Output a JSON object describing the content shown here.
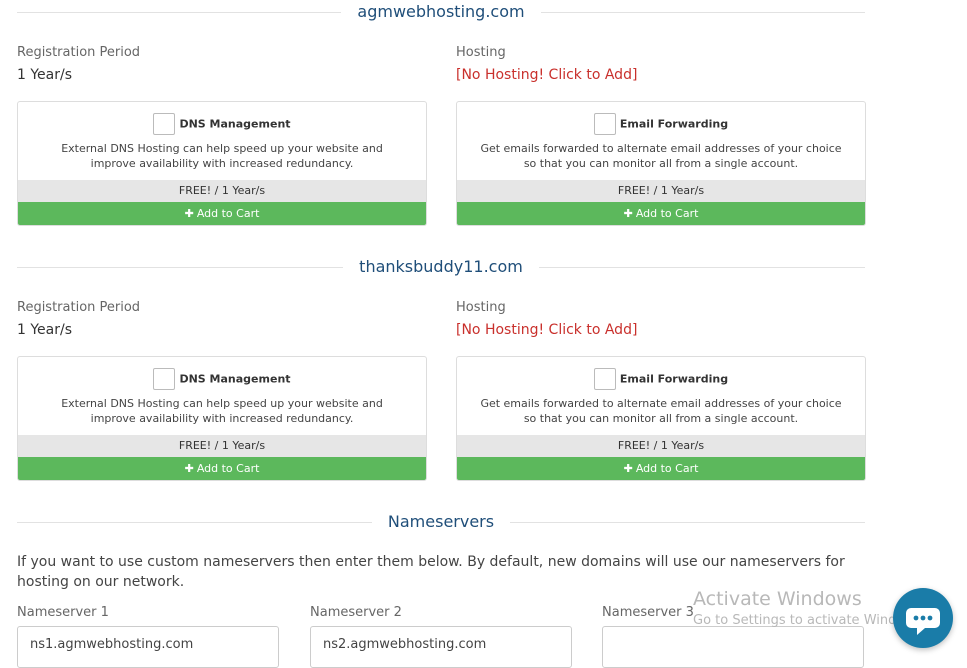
{
  "domains": [
    {
      "name": "agmwebhosting.com",
      "registration_label": "Registration Period",
      "registration_value": "1 Year/s",
      "hosting_label": "Hosting",
      "hosting_link": "[No Hosting! Click to Add]",
      "addons": [
        {
          "title": "DNS Management",
          "description": "External DNS Hosting can help speed up your website and improve availability with increased redundancy.",
          "price": "FREE! / 1 Year/s",
          "cart": "Add to Cart"
        },
        {
          "title": "Email Forwarding",
          "description": "Get emails forwarded to alternate email addresses of your choice so that you can monitor all from a single account.",
          "price": "FREE! / 1 Year/s",
          "cart": "Add to Cart"
        }
      ]
    },
    {
      "name": "thanksbuddy11.com",
      "registration_label": "Registration Period",
      "registration_value": "1 Year/s",
      "hosting_label": "Hosting",
      "hosting_link": "[No Hosting! Click to Add]",
      "addons": [
        {
          "title": "DNS Management",
          "description": "External DNS Hosting can help speed up your website and improve availability with increased redundancy.",
          "price": "FREE! / 1 Year/s",
          "cart": "Add to Cart"
        },
        {
          "title": "Email Forwarding",
          "description": "Get emails forwarded to alternate email addresses of your choice so that you can monitor all from a single account.",
          "price": "FREE! / 1 Year/s",
          "cart": "Add to Cart"
        }
      ]
    }
  ],
  "nameservers": {
    "heading": "Nameservers",
    "intro": "If you want to use custom nameservers then enter them below. By default, new domains will use our nameservers for hosting on our network.",
    "fields": [
      {
        "label": "Nameserver 1",
        "value": "ns1.agmwebhosting.com"
      },
      {
        "label": "Nameserver 2",
        "value": "ns2.agmwebhosting.com"
      },
      {
        "label": "Nameserver 3",
        "value": ""
      }
    ]
  },
  "watermark": {
    "line1": "Activate Windows",
    "line2": "Go to Settings to activate Windows."
  },
  "colors": {
    "heading": "#1f4e79",
    "hosting_link": "#c9302c",
    "cart_button": "#5cb85c",
    "price_bar": "#e6e6e6",
    "chat_bubble": "#1a7ca8"
  },
  "icons": {
    "cart_plus": "plus-icon",
    "chat": "chat-icon"
  }
}
